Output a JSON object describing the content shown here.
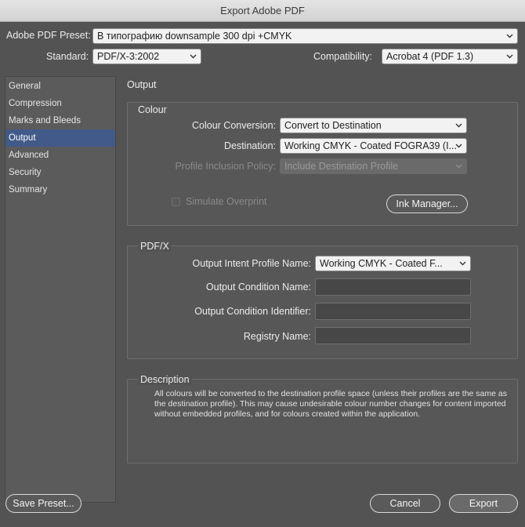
{
  "window": {
    "title": "Export Adobe PDF"
  },
  "preset": {
    "label": "Adobe PDF Preset:",
    "value": "В типографию downsample 300 dpi +CMYK"
  },
  "standard": {
    "label": "Standard:",
    "value": "PDF/X-3:2002"
  },
  "compatibility": {
    "label": "Compatibility:",
    "value": "Acrobat 4 (PDF 1.3)"
  },
  "sidebar": {
    "items": [
      {
        "label": "General"
      },
      {
        "label": "Compression"
      },
      {
        "label": "Marks and Bleeds"
      },
      {
        "label": "Output"
      },
      {
        "label": "Advanced"
      },
      {
        "label": "Security"
      },
      {
        "label": "Summary"
      }
    ]
  },
  "panel": {
    "title": "Output"
  },
  "colour": {
    "title": "Colour",
    "conversion_label": "Colour Conversion:",
    "conversion_value": "Convert to Destination",
    "destination_label": "Destination:",
    "destination_value": "Working CMYK - Coated FOGRA39 (I...",
    "inclusion_label": "Profile Inclusion Policy:",
    "inclusion_value": "Include Destination Profile",
    "simulate_label": "Simulate Overprint",
    "ink_manager_label": "Ink Manager..."
  },
  "pdfx": {
    "title": "PDF/X",
    "intent_label": "Output Intent Profile Name:",
    "intent_value": "Working CMYK - Coated F...",
    "condition_name_label": "Output Condition Name:",
    "condition_id_label": "Output Condition Identifier:",
    "registry_label": "Registry Name:"
  },
  "description": {
    "title": "Description",
    "text": "All colours will be converted to the destination profile space (unless their profiles are the same as the destination profile). This may cause undesirable colour number changes for content imported without embedded profiles, and for colours created within the application."
  },
  "footer": {
    "save_preset": "Save Preset...",
    "cancel": "Cancel",
    "export": "Export"
  }
}
